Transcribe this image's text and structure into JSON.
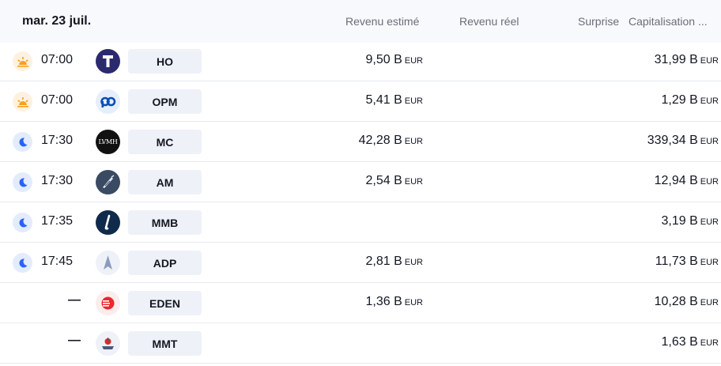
{
  "header": {
    "date": "mar. 23 juil.",
    "columns": {
      "revenu_estime": "Revenu estimé",
      "revenu_reel": "Revenu réel",
      "surprise": "Surprise",
      "capitalisation": "Capitalisation ..."
    }
  },
  "colors": {
    "header_bg": "#f8f9fd",
    "ticker_bg": "#eef1f8",
    "sun_bg": "#fff1e0",
    "sun_icon": "#f7a21b",
    "moon_bg": "#e3ecfd",
    "moon_icon": "#2962ff",
    "divider": "#e8eaf0"
  },
  "rows": [
    {
      "time_icon": "sun-icon",
      "time": "07:00",
      "logo": "tick-logo-HO",
      "ticker": "HO",
      "revenu_estime": "9,50 B",
      "revenu_estime_unit": "EUR",
      "capitalisation": "31,99 B",
      "capitalisation_unit": "EUR"
    },
    {
      "time_icon": "sun-icon",
      "time": "07:00",
      "logo": "tick-logo-OPM",
      "ticker": "OPM",
      "revenu_estime": "5,41 B",
      "revenu_estime_unit": "EUR",
      "capitalisation": "1,29 B",
      "capitalisation_unit": "EUR"
    },
    {
      "time_icon": "moon-icon",
      "time": "17:30",
      "logo": "tick-logo-MC",
      "logo_text": "LVMH",
      "ticker": "MC",
      "revenu_estime": "42,28 B",
      "revenu_estime_unit": "EUR",
      "capitalisation": "339,34 B",
      "capitalisation_unit": "EUR"
    },
    {
      "time_icon": "moon-icon",
      "time": "17:30",
      "logo": "tick-logo-AM",
      "ticker": "AM",
      "revenu_estime": "2,54 B",
      "revenu_estime_unit": "EUR",
      "capitalisation": "12,94 B",
      "capitalisation_unit": "EUR"
    },
    {
      "time_icon": "moon-icon",
      "time": "17:35",
      "logo": "tick-logo-MMB",
      "ticker": "MMB",
      "revenu_estime": "",
      "revenu_estime_unit": "",
      "capitalisation": "3,19 B",
      "capitalisation_unit": "EUR"
    },
    {
      "time_icon": "moon-icon",
      "time": "17:45",
      "logo": "tick-logo-ADP",
      "ticker": "ADP",
      "revenu_estime": "2,81 B",
      "revenu_estime_unit": "EUR",
      "capitalisation": "11,73 B",
      "capitalisation_unit": "EUR"
    },
    {
      "time_icon": "",
      "time": "—",
      "logo": "tick-logo-EDEN",
      "ticker": "EDEN",
      "revenu_estime": "1,36 B",
      "revenu_estime_unit": "EUR",
      "capitalisation": "10,28 B",
      "capitalisation_unit": "EUR"
    },
    {
      "time_icon": "",
      "time": "—",
      "logo": "tick-logo-MMT",
      "ticker": "MMT",
      "revenu_estime": "",
      "revenu_estime_unit": "",
      "capitalisation": "1,63 B",
      "capitalisation_unit": "EUR"
    }
  ]
}
